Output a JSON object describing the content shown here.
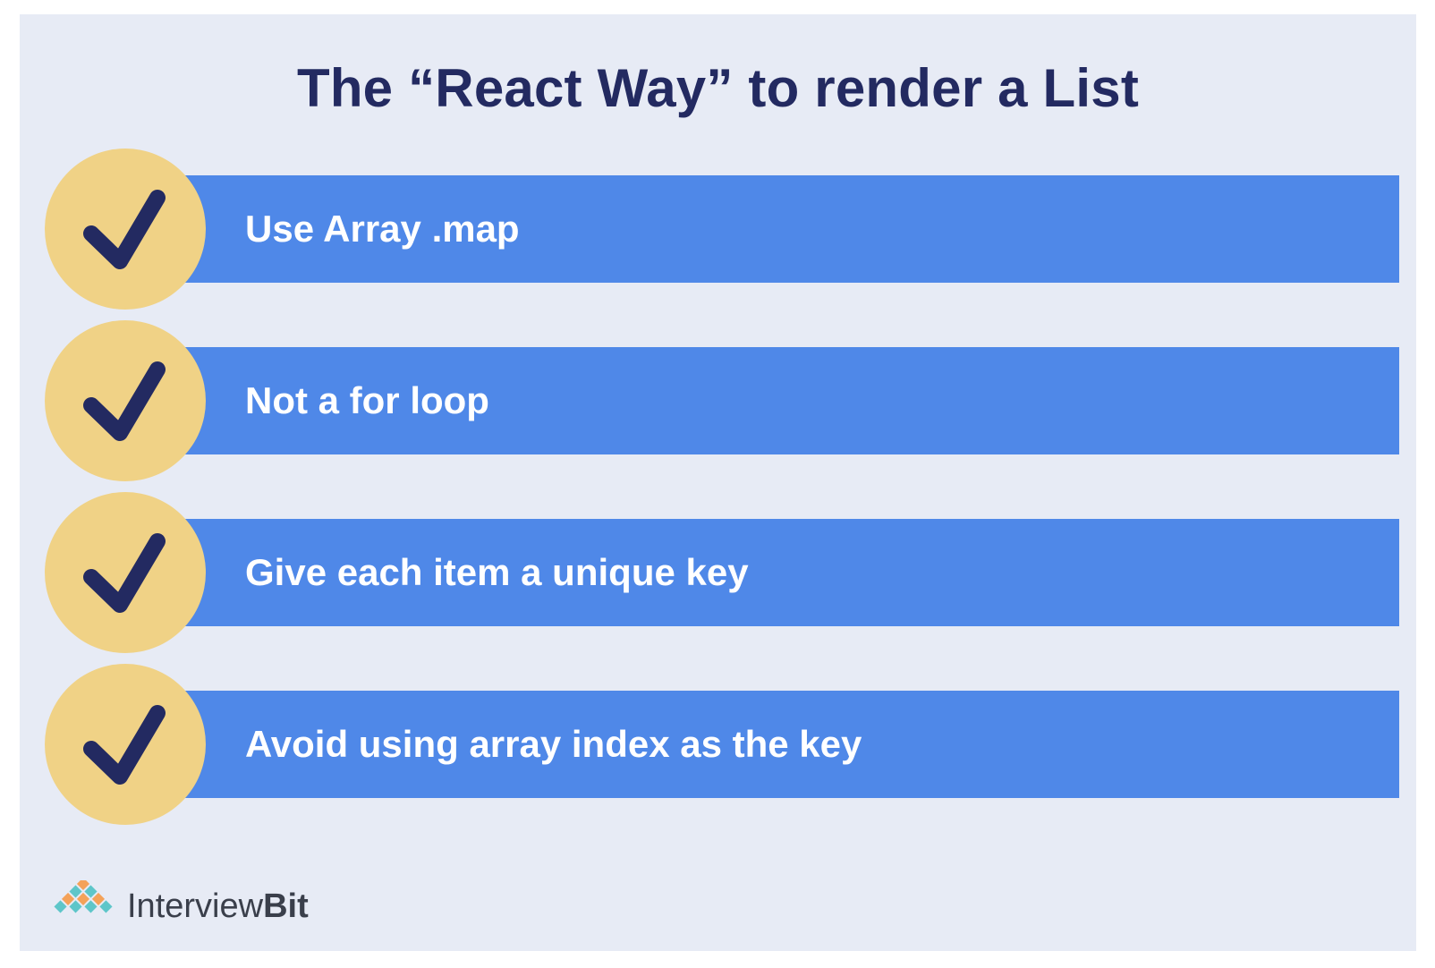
{
  "title": "The “React Way” to render a List",
  "items": [
    {
      "label": "Use Array .map"
    },
    {
      "label": "Not a for loop"
    },
    {
      "label": "Give each item a unique key"
    },
    {
      "label": "Avoid using array index as the key"
    }
  ],
  "brand": {
    "part1": "Interview",
    "part2": "Bit"
  },
  "colors": {
    "background": "#e7ebf5",
    "bar": "#4f88e8",
    "circle": "#f0d286",
    "check": "#232a61",
    "title": "#232a61"
  },
  "icons": [
    "check-icon",
    "interviewbit-logo-icon"
  ]
}
